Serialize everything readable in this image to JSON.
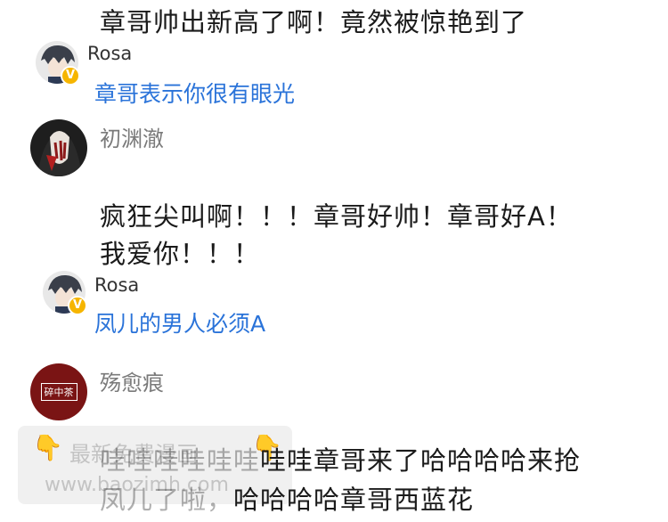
{
  "top_comment_text": "章哥帅出新高了啊！竟然被惊艳到了",
  "reply1": {
    "username": "Rosa",
    "badge": "V",
    "text": "章哥表示你很有眼光"
  },
  "comment2": {
    "username": "初渊澈",
    "line1": "疯狂尖叫啊！！！章哥好帅！章哥好A！",
    "line2": "我爱你！！！"
  },
  "reply2": {
    "username": "Rosa",
    "badge": "V",
    "text": "凤儿的男人必须A"
  },
  "comment3": {
    "username": "殇愈痕",
    "avatar_text": "碎中茶",
    "line1_pre": "哇哇哇哇哇哇",
    "line1_post": "哇哇章哥来了哈哈哈哈来抢",
    "line2_pre": "凤儿了啦，",
    "line2_post": "哈哈哈哈章哥西蓝花"
  },
  "watermark": {
    "line1": "最新免费漫画",
    "line2": "www.baozimh.com"
  },
  "colors": {
    "link_blue": "#2a73d9",
    "badge_gold": "#f6b500",
    "hand_orange": "#f5a623"
  }
}
